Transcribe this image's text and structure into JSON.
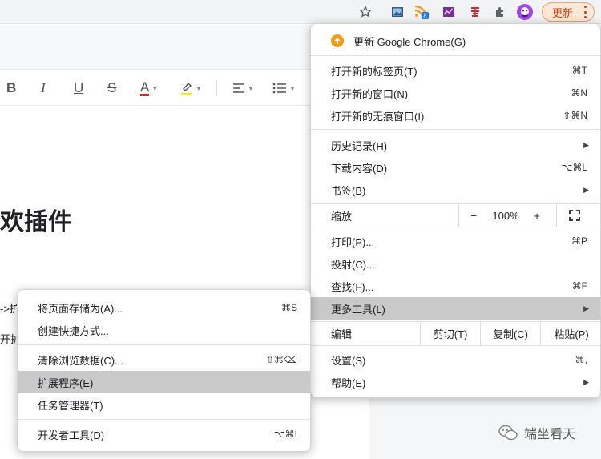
{
  "toolbar": {
    "update_label": "更新",
    "ext_badge": "8"
  },
  "doc": {
    "heading": "欢插件",
    "frag1": "->扩展",
    "frag2": "开扩"
  },
  "watermark": "端坐看天",
  "menu": {
    "update_chrome": "更新 Google Chrome(G)",
    "new_tab": "打开新的标签页(T)",
    "new_tab_sc": "⌘T",
    "new_window": "打开新的窗口(N)",
    "new_window_sc": "⌘N",
    "incognito": "打开新的无痕窗口(I)",
    "incognito_sc": "⇧⌘N",
    "history": "历史记录(H)",
    "downloads": "下载内容(D)",
    "downloads_sc": "⌥⌘L",
    "bookmarks": "书签(B)",
    "zoom_label": "缩放",
    "zoom_minus": "−",
    "zoom_value": "100%",
    "zoom_plus": "+",
    "print": "打印(P)...",
    "print_sc": "⌘P",
    "cast": "投射(C)...",
    "find": "查找(F)...",
    "find_sc": "⌘F",
    "more_tools": "更多工具(L)",
    "edit_label": "编辑",
    "cut": "剪切(T)",
    "copy": "复制(C)",
    "paste": "粘贴(P)",
    "settings": "设置(S)",
    "settings_sc": "⌘,",
    "help": "帮助(E)"
  },
  "submenu": {
    "save_page": "将页面存储为(A)...",
    "save_page_sc": "⌘S",
    "create_shortcut": "创建快捷方式...",
    "clear_data": "清除浏览数据(C)...",
    "clear_data_sc": "⇧⌘⌫",
    "extensions": "扩展程序(E)",
    "task_manager": "任务管理器(T)",
    "dev_tools": "开发者工具(D)",
    "dev_tools_sc": "⌥⌘I"
  },
  "colors": {
    "accent": "#f39c12",
    "update_text": "#c0410f",
    "highlight": "#c9c9c9"
  }
}
